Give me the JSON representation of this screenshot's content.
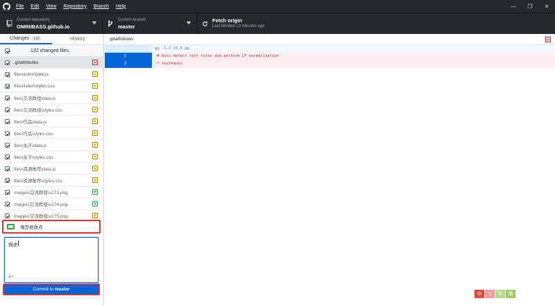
{
  "menu": {
    "file": "File",
    "edit": "Edit",
    "view": "View",
    "repository": "Repository",
    "branch": "Branch",
    "help": "Help"
  },
  "toolbar": {
    "repo_label": "Current repository",
    "repo_name": "OMINIBASS.github.io",
    "branch_label": "Current branch",
    "branch_name": "master",
    "fetch_title": "Fetch origin",
    "fetch_sub": "Last fetched 13 minutes ago"
  },
  "tabs": {
    "changes": "Changes",
    "changes_count": "137",
    "history": "History"
  },
  "changes_summary": "137 changed files",
  "files": [
    {
      "name": ".gitattributes",
      "status": "deleted"
    },
    {
      "name": "files\\index\\data.js",
      "status": "modified"
    },
    {
      "name": "files\\index\\styles.css",
      "status": "modified"
    },
    {
      "name": "files\\交流群组\\data.js",
      "status": "modified"
    },
    {
      "name": "files\\交流群组\\styles.css",
      "status": "modified"
    },
    {
      "name": "files\\作品\\data.js",
      "status": "modified"
    },
    {
      "name": "files\\作品\\styles.css",
      "status": "modified"
    },
    {
      "name": "files\\关于\\data.js",
      "status": "modified"
    },
    {
      "name": "files\\关于\\styles.css",
      "status": "modified"
    },
    {
      "name": "files\\资源推荐\\data.js",
      "status": "modified"
    },
    {
      "name": "files\\资源推荐\\styles.css",
      "status": "modified"
    },
    {
      "name": "images\\交流群组\\u173.png",
      "status": "added"
    },
    {
      "name": "images\\交流群组\\u174.png",
      "status": "added"
    },
    {
      "name": "images\\交流群组\\u175.png",
      "status": "modified"
    }
  ],
  "commit": {
    "summary": "填写修改点",
    "description": "描述",
    "coauthor": "A+",
    "button_prefix": "Commit to",
    "button_branch": "master"
  },
  "diff": {
    "path": ".gitattributes",
    "hunk": "@@ -1,2 +0,0 @@",
    "lines": [
      {
        "num": "1",
        "text": "-# Auto detect text files and perform LF normalization"
      },
      {
        "num": "2",
        "text": "-* text=auto"
      }
    ]
  },
  "ime": {
    "items": [
      "中",
      "ㄅ",
      "半",
      "简"
    ],
    "colors": [
      "#e8443a",
      "#f49b9b",
      "#b3d98f",
      "#9ccc65"
    ]
  }
}
